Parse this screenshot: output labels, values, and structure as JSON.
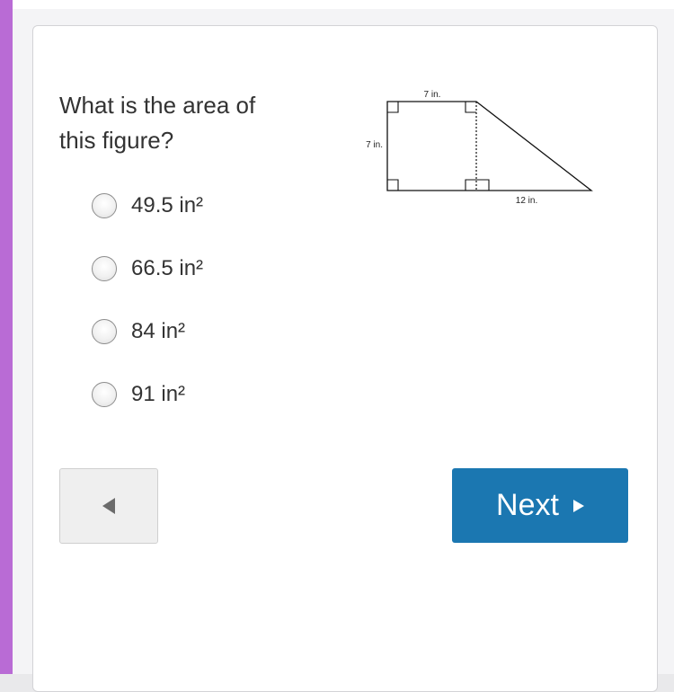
{
  "question": {
    "line1": "What is the area of",
    "line2": "this figure?"
  },
  "figure": {
    "top_label": "7 in.",
    "left_label": "7 in.",
    "bottom_label": "12 in."
  },
  "options": [
    {
      "label": "49.5 in²",
      "selected": false
    },
    {
      "label": "66.5 in²",
      "selected": false
    },
    {
      "label": "84 in²",
      "selected": false
    },
    {
      "label": "91 in²",
      "selected": false
    }
  ],
  "navigation": {
    "back_icon": "left-triangle-icon",
    "next_label": "Next",
    "next_icon": "right-triangle-icon"
  },
  "colors": {
    "accent": "#b96bd5",
    "next_button": "#1b77b1"
  }
}
